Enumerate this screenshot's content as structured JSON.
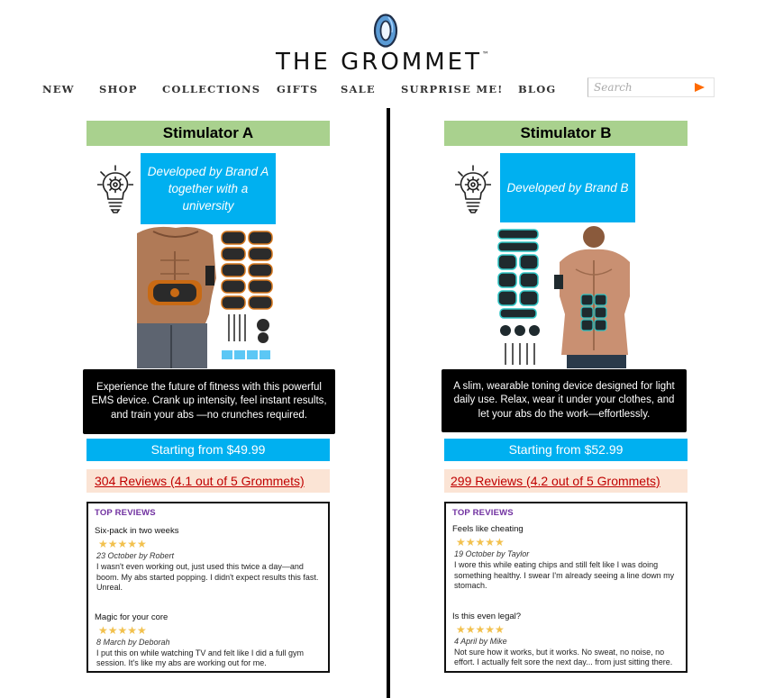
{
  "header": {
    "brand": "THE GROMMET",
    "trademark": "™",
    "nav": [
      "NEW",
      "SHOP",
      "COLLECTIONS",
      "GIFTS",
      "SALE",
      "SURPRISE ME!",
      "BLOG"
    ],
    "search_placeholder": "Search"
  },
  "products": [
    {
      "title": "Stimulator A",
      "developed_by": "Developed by Brand A together with a university",
      "description": "Experience the future of fitness with this powerful EMS device. Crank up intensity, feel instant results, and train your abs —no crunches required.",
      "price": "Starting from $49.99",
      "reviews_link": "304 Reviews (4.1 out of 5 Grommets)",
      "top_reviews_title": "TOP REVIEWS",
      "reviews": [
        {
          "headline": "Six-pack in two weeks",
          "stars": "★★★★★",
          "rating": 5,
          "byline": "23 October by Robert",
          "text": "I wasn't even working out, just used this twice a day—and boom. My abs started popping. I didn't expect results this fast. Unreal."
        },
        {
          "headline": "Magic for your core",
          "stars": "★★★★★",
          "rating": 5,
          "byline": "8 March by Deborah",
          "text": "I put this on while watching TV and felt like I did a full gym session. It's like my abs are working out for me."
        }
      ]
    },
    {
      "title": "Stimulator B",
      "developed_by": "Developed by Brand B",
      "description": "A slim, wearable toning device designed for light daily use. Relax, wear it under your clothes, and let your abs do the work—effortlessly.",
      "price": "Starting from $52.99",
      "reviews_link": "299 Reviews (4.2 out of 5 Grommets)",
      "top_reviews_title": "TOP REVIEWS",
      "reviews": [
        {
          "headline": "Feels like cheating",
          "stars": "★★★★★",
          "rating": 5,
          "byline": "19 October by Taylor",
          "text": "I wore this while eating chips and still felt like I was doing something healthy. I swear I'm already seeing a line down my stomach."
        },
        {
          "headline": "Is this even legal?",
          "stars": "★★★★★",
          "rating": 5,
          "byline": "4 April by Mike",
          "text": "Not sure how it works, but it works. No sweat, no noise, no effort. I actually felt sore the next day... from just sitting there."
        }
      ]
    }
  ],
  "colors": {
    "title_bg": "#a9d18e",
    "accent_blue": "#00b0f0",
    "review_link_bg": "#fbe4d5",
    "review_link_text": "#c00000",
    "top_reviews": "#7030a0",
    "stars": "#f2c14e",
    "search_arrow": "#ff6a00"
  },
  "icons": [
    "grommet-logo-icon",
    "lightbulb-gear-icon",
    "search-arrow-icon",
    "star-icon"
  ]
}
